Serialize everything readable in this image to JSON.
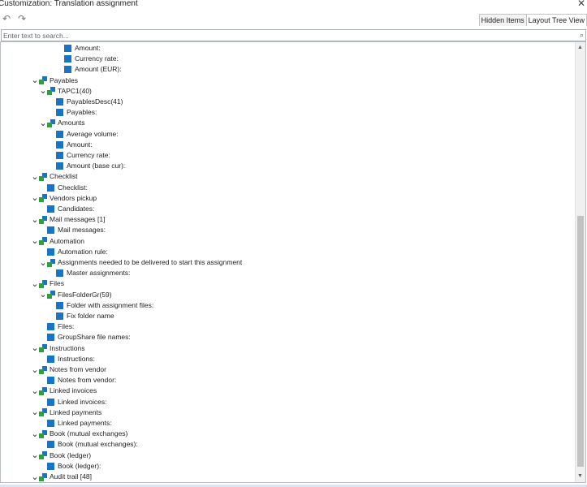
{
  "window": {
    "title": "Customization: Translation assignment",
    "close_glyph": "✕"
  },
  "toolbar": {
    "undo_glyph": "↶",
    "redo_glyph": "↷"
  },
  "tabs": [
    {
      "label": "Hidden Items",
      "active": false
    },
    {
      "label": "Layout Tree View",
      "active": true
    }
  ],
  "search": {
    "placeholder": "Enter text to search...",
    "value": "",
    "icon_glyph": "⌕"
  },
  "tree": {
    "nodes": [
      {
        "label": "Amount:",
        "level": 3,
        "kind": "leaf"
      },
      {
        "label": "Currency rate:",
        "level": 3,
        "kind": "leaf"
      },
      {
        "label": "Amount (EUR):",
        "level": 3,
        "kind": "leaf"
      },
      {
        "label": "Payables",
        "level": 0,
        "kind": "group"
      },
      {
        "label": "TAPC1(40)",
        "level": 1,
        "kind": "group"
      },
      {
        "label": "PayablesDesc(41)",
        "level": 2,
        "kind": "leaf"
      },
      {
        "label": "Payables:",
        "level": 2,
        "kind": "leaf"
      },
      {
        "label": "Amounts",
        "level": 1,
        "kind": "group"
      },
      {
        "label": "Average volume:",
        "level": 2,
        "kind": "leaf"
      },
      {
        "label": "Amount:",
        "level": 2,
        "kind": "leaf"
      },
      {
        "label": "Currency rate:",
        "level": 2,
        "kind": "leaf"
      },
      {
        "label": "Amount (base cur):",
        "level": 2,
        "kind": "leaf"
      },
      {
        "label": "Checklist",
        "level": 0,
        "kind": "group"
      },
      {
        "label": "Checklist:",
        "level": 1,
        "kind": "leaf"
      },
      {
        "label": "Vendors pickup",
        "level": 0,
        "kind": "group"
      },
      {
        "label": "Candidates:",
        "level": 1,
        "kind": "leaf"
      },
      {
        "label": "Mail messages [1]",
        "level": 0,
        "kind": "group"
      },
      {
        "label": "Mail messages:",
        "level": 1,
        "kind": "leaf"
      },
      {
        "label": "Automation",
        "level": 0,
        "kind": "group"
      },
      {
        "label": "Automation rule:",
        "level": 1,
        "kind": "leaf"
      },
      {
        "label": "Assignments needed to be delivered to start this assignment",
        "level": 1,
        "kind": "group"
      },
      {
        "label": "Master assignments:",
        "level": 2,
        "kind": "leaf"
      },
      {
        "label": "Files",
        "level": 0,
        "kind": "group"
      },
      {
        "label": "FilesFolderGr(59)",
        "level": 1,
        "kind": "group"
      },
      {
        "label": "Folder with assignment files:",
        "level": 2,
        "kind": "leaf"
      },
      {
        "label": "Fix folder name",
        "level": 2,
        "kind": "leaf"
      },
      {
        "label": "Files:",
        "level": 1,
        "kind": "leaf"
      },
      {
        "label": "GroupShare file names:",
        "level": 1,
        "kind": "leaf"
      },
      {
        "label": "Instructions",
        "level": 0,
        "kind": "group"
      },
      {
        "label": "Instructions:",
        "level": 1,
        "kind": "leaf"
      },
      {
        "label": "Notes from vendor",
        "level": 0,
        "kind": "group"
      },
      {
        "label": "Notes from vendor:",
        "level": 1,
        "kind": "leaf"
      },
      {
        "label": "Linked invoices",
        "level": 0,
        "kind": "group"
      },
      {
        "label": "Linked invoices:",
        "level": 1,
        "kind": "leaf"
      },
      {
        "label": "Linked payments",
        "level": 0,
        "kind": "group"
      },
      {
        "label": "Linked payments:",
        "level": 1,
        "kind": "leaf"
      },
      {
        "label": "Book (mutual exchanges)",
        "level": 0,
        "kind": "group"
      },
      {
        "label": "Book (mutual exchanges):",
        "level": 1,
        "kind": "leaf"
      },
      {
        "label": "Book (ledger)",
        "level": 0,
        "kind": "group"
      },
      {
        "label": "Book (ledger):",
        "level": 1,
        "kind": "leaf"
      },
      {
        "label": "Audit trail [48]",
        "level": 0,
        "kind": "group"
      }
    ]
  },
  "scrollbar": {
    "up_glyph": "▲",
    "down_glyph": "▼"
  },
  "colors": {
    "leaf_icon": "#1874c4",
    "group_icon_blue": "#1874c4",
    "group_icon_green": "#2e9f3c"
  }
}
